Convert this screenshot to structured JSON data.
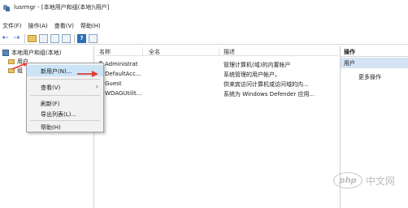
{
  "window": {
    "title": "lusrmgr - [本地用户和组(本地)\\用户]"
  },
  "menubar": {
    "items": [
      "文件(F)",
      "操作(A)",
      "查看(V)",
      "帮助(H)"
    ]
  },
  "tree": {
    "root": "本地用户和组(本地)",
    "users": "用户",
    "groups": "组"
  },
  "list": {
    "headers": {
      "name": "名称",
      "fullname": "全名",
      "description": "描述"
    },
    "rows": [
      {
        "name": "Administrat",
        "fullname": "",
        "description": "管理计算机(域)的内置帐户"
      },
      {
        "name": "DefaultAcc...",
        "fullname": "",
        "description": "系统管理的用户帐户。"
      },
      {
        "name": "Guest",
        "fullname": "",
        "description": "供来宾访问计算机或访问域的内..."
      },
      {
        "name": "WDAGUtilit...",
        "fullname": "",
        "description": "系统为 Windows Defender 应用..."
      }
    ]
  },
  "context_menu": {
    "new_user": "新用户(N)...",
    "view": "查看(V)",
    "refresh": "刷新(F)",
    "export": "导出列表(L)...",
    "help": "帮助(H)"
  },
  "actions": {
    "header": "操作",
    "section": "用户",
    "more": "更多操作"
  },
  "watermark": {
    "logo": "php",
    "text": "中文网"
  },
  "colors": {
    "highlight": "#cce4f7",
    "actions_section": "#d3e3f4",
    "annotation_arrow": "#e53935"
  }
}
